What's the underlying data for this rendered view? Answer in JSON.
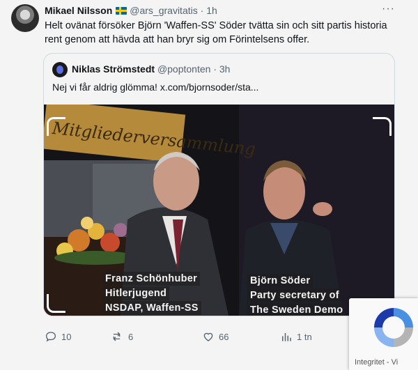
{
  "tweet": {
    "author_name": "Mikael Nilsson",
    "handle": "@ars_gravitatis",
    "separator": "·",
    "time": "1h",
    "more": "···",
    "text": "Helt ovänat försöker Björn 'Waffen-SS' Söder tvätta sin och sitt partis historia rent genom att hävda att han bryr sig om Förintelsens offer."
  },
  "quoted": {
    "author_name": "Niklas Strömstedt",
    "handle": "@poptonten",
    "separator": "·",
    "time": "3h",
    "text": "Nej vi får aldrig glömma!  x.com/bjornsoder/sta...",
    "image": {
      "banner_text": "Mitgliederversammlung",
      "caption_left": [
        "Franz Schönhuber",
        "Hitlerjugend",
        "NSDAP, Waffen-SS"
      ],
      "caption_right": [
        "Björn Söder",
        "Party secretary  of",
        "The Sweden Demo"
      ]
    }
  },
  "actions": {
    "replies": "10",
    "reposts": "6",
    "likes": "66",
    "views": "1 tn"
  },
  "recaptcha": {
    "label": "Integritet - Vi"
  },
  "colors": {
    "background": "#f4f4f4",
    "secondary_text": "#536471",
    "border": "#cfd9de",
    "recaptcha_blue": "#4a90e2"
  }
}
